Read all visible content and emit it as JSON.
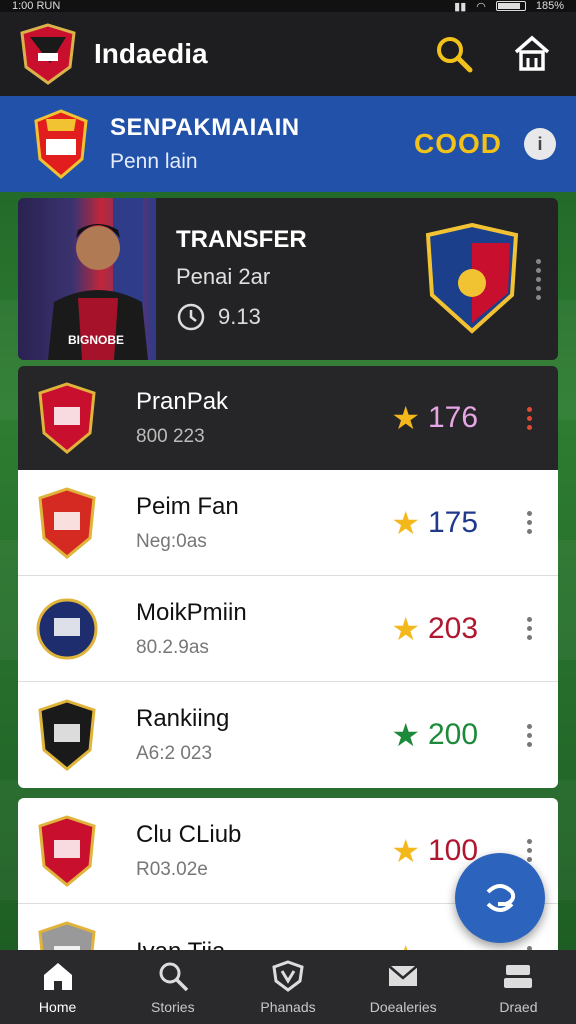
{
  "status_bar": {
    "time": "1:00 RUN",
    "battery": "185%"
  },
  "app_bar": {
    "title": "Indaedia",
    "icons": [
      "search-icon",
      "home-icon"
    ]
  },
  "header": {
    "title": "SENPAKMAIAIN",
    "subtitle": "Penn lain",
    "code": "COOD",
    "info_label": "i"
  },
  "transfer": {
    "title": "TRANSFER",
    "subtitle": "Penai 2ar",
    "time": "9.13",
    "jersey_text": "BIGNOBE"
  },
  "clubs": [
    {
      "name": "PranPak",
      "sub": "800 223",
      "score": "176",
      "score_color": "#e7a6e6",
      "star_color": "#f3b81c",
      "dark": true
    },
    {
      "name": "Peim Fan",
      "sub": "Neg:0as",
      "score": "175",
      "score_color": "#1f3a8c",
      "star_color": "#f3b81c",
      "dark": false
    },
    {
      "name": "MoikPmiin",
      "sub": "80.2.9as",
      "score": "203",
      "score_color": "#b0172f",
      "star_color": "#f3b81c",
      "dark": false
    },
    {
      "name": "Rankiing",
      "sub": "A6:2 023",
      "score": "200",
      "score_color": "#1c8a3a",
      "star_color": "#1c8a3a",
      "dark": false
    }
  ],
  "clubs2": [
    {
      "name": "Clu CLiub",
      "sub": "R03.02e",
      "score": "100",
      "score_color": "#b0172f",
      "star_color": "#f3b81c"
    },
    {
      "name": "Ivan Tiia",
      "sub": "",
      "score": "",
      "score_color": "#b0172f",
      "star_color": "#f3b81c"
    }
  ],
  "bottom_nav": [
    {
      "label": "Home",
      "icon": "home-icon"
    },
    {
      "label": "Stories",
      "icon": "search-icon"
    },
    {
      "label": "Phanads",
      "icon": "shield-icon"
    },
    {
      "label": "Doealeries",
      "icon": "mail-icon"
    },
    {
      "label": "Draed",
      "icon": "tray-icon"
    }
  ],
  "colors": {
    "accent_blue": "#2151a8",
    "gold": "#f2c21a",
    "dark_card": "#232325"
  }
}
